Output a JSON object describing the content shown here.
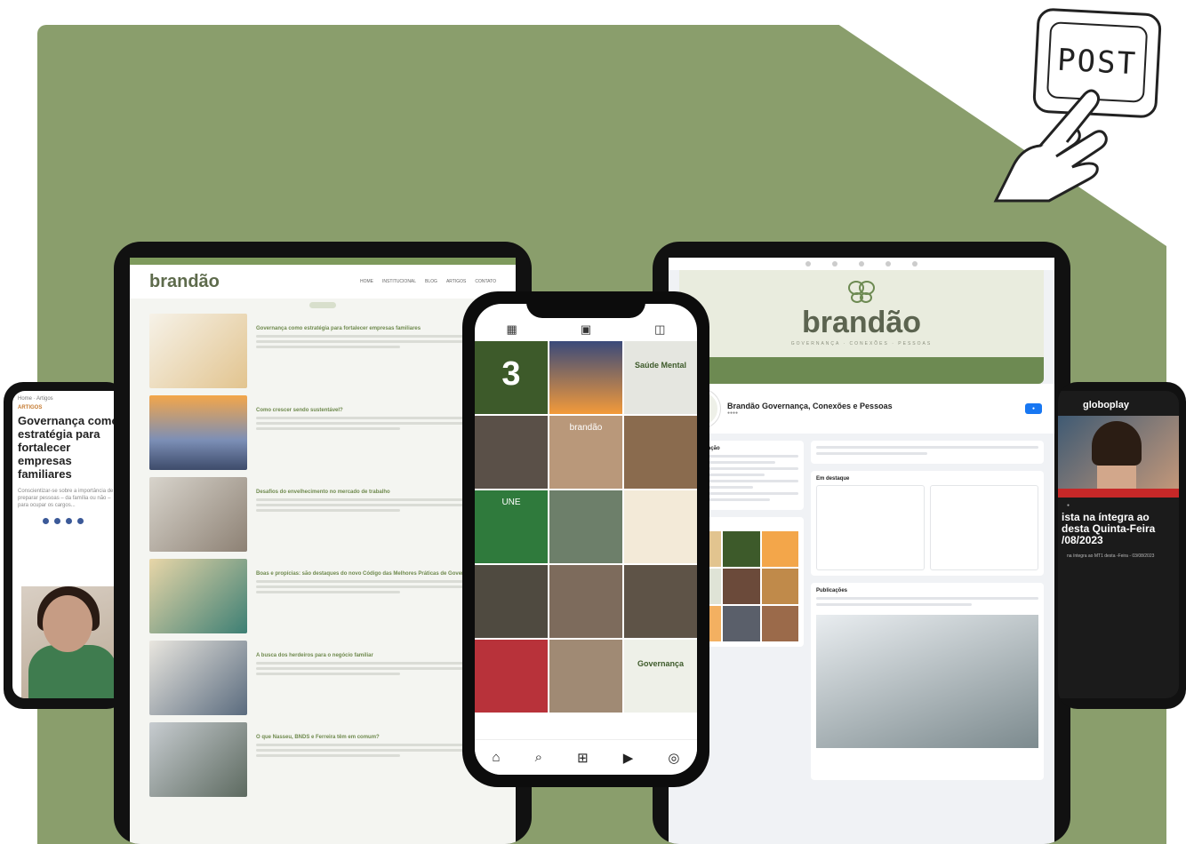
{
  "post_button": {
    "label": "POST"
  },
  "left_tablet": {
    "nav": "Home · Artigos",
    "category": "ARTIGOS",
    "title": "Governança como estratégia para fortalecer empresas familiares",
    "text": "Conscientizar-se sobre a importância de preparar pessoas – da família ou não – para ocupar os cargos..."
  },
  "website": {
    "logo": "brandão",
    "menu": [
      "HOME",
      "INSTITUCIONAL",
      "BLOG",
      "ARTIGOS",
      "CONTATO"
    ],
    "articles": [
      {
        "title": "Governança como estratégia para fortalecer empresas familiares"
      },
      {
        "title": "Como crescer sendo sustentável?"
      },
      {
        "title": "Desafios do envelhecimento no mercado de trabalho"
      },
      {
        "title": "Boas e propícias: são destaques do novo Código das Melhores Práticas de Governança"
      },
      {
        "title": "A busca dos herdeiros para o negócio familiar"
      },
      {
        "title": "O que Nasseu, BNDS e Ferreira têm em comum?"
      }
    ]
  },
  "instagram": {
    "tiles": [
      {
        "text": "3"
      },
      {
        "text": ""
      },
      {
        "text": "Saúde Mental"
      },
      {
        "text": ""
      },
      {
        "text": "brandão"
      },
      {
        "text": ""
      },
      {
        "text": "UNE"
      },
      {
        "text": ""
      },
      {
        "text": ""
      },
      {
        "text": ""
      },
      {
        "text": ""
      },
      {
        "text": ""
      },
      {
        "text": ""
      },
      {
        "text": ""
      },
      {
        "text": "Governança"
      }
    ]
  },
  "facebook": {
    "cover_logo": "brandão",
    "cover_sub": "GOVERNANÇA · CONEXÕES · PESSOAS",
    "page_name": "Brandão Governança, Conexões e Pessoas",
    "intro_heading": "Apresentação",
    "highlights_heading": "Em destaque",
    "photos_heading": "Fotos",
    "posts_heading": "Publicações"
  },
  "right_tablet": {
    "brand": "globoplay",
    "title": "ista na íntegra ao desta Quinta-Feira /08/2023",
    "text": "na íntegra ao MT1 desta -Feira - 03/08/2023"
  },
  "colors": {
    "accent": "#8a9e6c",
    "brand_green": "#6d8a52"
  }
}
